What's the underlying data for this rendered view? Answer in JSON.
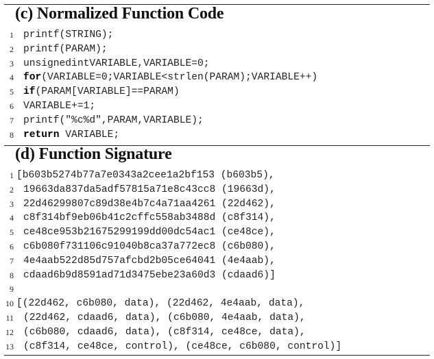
{
  "section_c": {
    "title": "(c) Normalized Function Code",
    "lines": [
      {
        "num": "1",
        "segments": [
          {
            "text": "printf(STRING);"
          }
        ]
      },
      {
        "num": "2",
        "segments": [
          {
            "text": "printf(PARAM);"
          }
        ]
      },
      {
        "num": "3",
        "segments": [
          {
            "text": "unsignedintVARIABLE,VARIABLE=0;"
          }
        ]
      },
      {
        "num": "4",
        "segments": [
          {
            "text": "for",
            "kw": true
          },
          {
            "text": "(VARIABLE=0;VARIABLE<strlen(PARAM);VARIABLE++)"
          }
        ]
      },
      {
        "num": "5",
        "segments": [
          {
            "text": "if",
            "kw": true
          },
          {
            "text": "(PARAM[VARIABLE]==PARAM)"
          }
        ]
      },
      {
        "num": "6",
        "segments": [
          {
            "text": "VARIABLE+=1;"
          }
        ]
      },
      {
        "num": "7",
        "segments": [
          {
            "text": "printf(\"%c%d\",PARAM,VARIABLE);"
          }
        ]
      },
      {
        "num": "8",
        "segments": [
          {
            "text": "return",
            "kw": true
          },
          {
            "text": " VARIABLE;"
          }
        ]
      }
    ]
  },
  "section_d": {
    "title": "(d) Function Signature",
    "lines": [
      {
        "num": "1",
        "flush": true,
        "segments": [
          {
            "text": "[b603b5274b77a7e0343a2cee1a2bf153 (b603b5),"
          }
        ]
      },
      {
        "num": "2",
        "segments": [
          {
            "text": "19663da837da5adf57815a71e8c43cc8 (19663d),"
          }
        ]
      },
      {
        "num": "3",
        "segments": [
          {
            "text": "22d46299807c89d38e4b7c4a71aa4261 (22d462),"
          }
        ]
      },
      {
        "num": "4",
        "segments": [
          {
            "text": "c8f314bf9eb06b41c2cffc558ab3488d (c8f314),"
          }
        ]
      },
      {
        "num": "5",
        "segments": [
          {
            "text": "ce48ce953b21675299199dd00dc54ac1 (ce48ce),"
          }
        ]
      },
      {
        "num": "6",
        "segments": [
          {
            "text": "c6b080f731106c91040b8ca37a772ec8 (c6b080),"
          }
        ]
      },
      {
        "num": "7",
        "segments": [
          {
            "text": "4e4aab522d85d757afcbd2b05ce64041 (4e4aab),"
          }
        ]
      },
      {
        "num": "8",
        "segments": [
          {
            "text": "cdaad6b9d8591ad71d3475ebe23a60d3 (cdaad6)]"
          }
        ]
      },
      {
        "num": "9",
        "segments": [
          {
            "text": ""
          }
        ]
      },
      {
        "num": "10",
        "flush": true,
        "segments": [
          {
            "text": "[(22d462, c6b080, data), (22d462, 4e4aab, data),"
          }
        ]
      },
      {
        "num": "11",
        "segments": [
          {
            "text": "(22d462, cdaad6, data), (c6b080, 4e4aab, data),"
          }
        ]
      },
      {
        "num": "12",
        "segments": [
          {
            "text": "(c6b080, cdaad6, data), (c8f314, ce48ce, data),"
          }
        ]
      },
      {
        "num": "13",
        "segments": [
          {
            "text": "(c8f314, ce48ce, control), (ce48ce, c6b080, control)]"
          }
        ]
      }
    ]
  }
}
